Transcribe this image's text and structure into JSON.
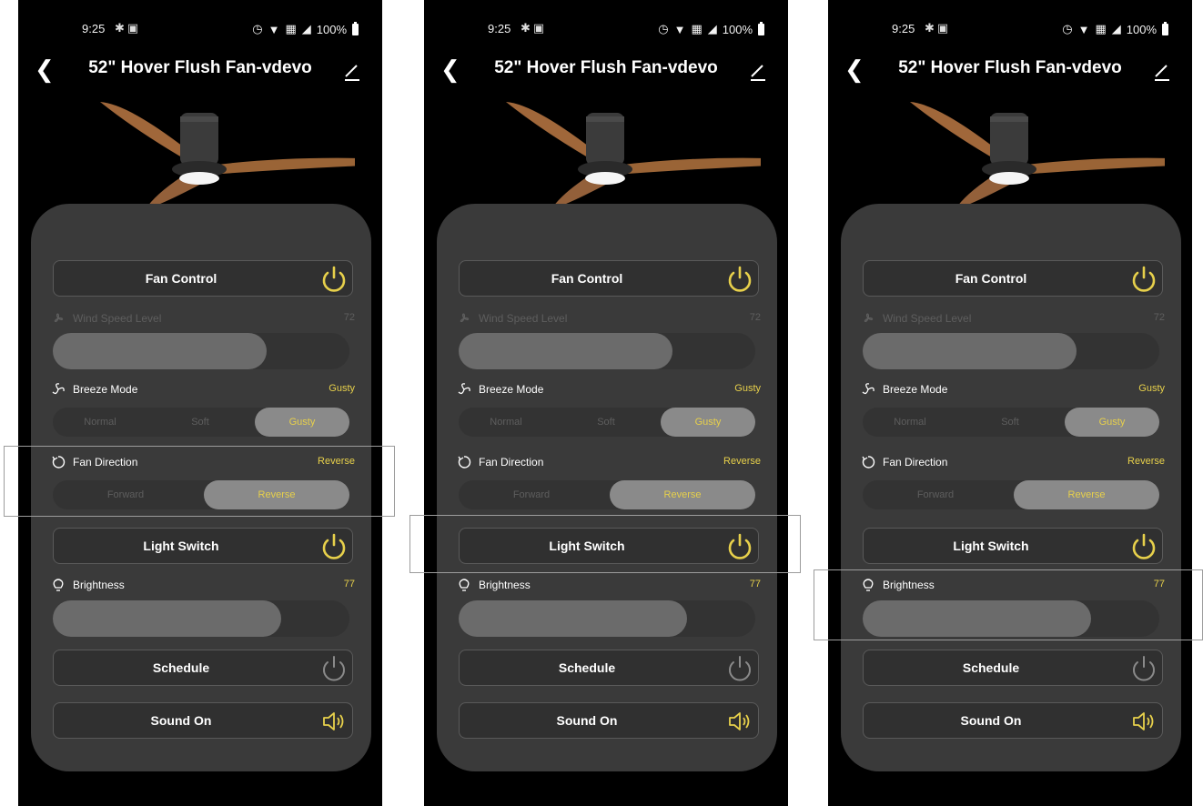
{
  "status": {
    "time": "9:25",
    "battery": "100%"
  },
  "header": {
    "title": "52\" Hover Flush Fan-vdevo"
  },
  "fan_control": {
    "label": "Fan Control"
  },
  "wind_speed": {
    "label": "Wind Speed Level",
    "value": "72",
    "level": 0.72
  },
  "breeze": {
    "label": "Breeze Mode",
    "value": "Gusty",
    "options": [
      "Normal",
      "Soft",
      "Gusty"
    ]
  },
  "direction": {
    "label": "Fan Direction",
    "value": "Reverse",
    "options": [
      "Forward",
      "Reverse"
    ]
  },
  "light_switch": {
    "label": "Light Switch"
  },
  "brightness": {
    "label": "Brightness",
    "value": "77",
    "level": 0.77
  },
  "schedule": {
    "label": "Schedule"
  },
  "sound": {
    "label": "Sound On"
  },
  "colors": {
    "accent": "#e7d04b",
    "card": "#3a3a3a",
    "background": "#000000"
  },
  "icons": [
    "back-icon",
    "edit-icon",
    "fan-icon",
    "breeze-icon",
    "rotate-icon",
    "bulb-icon",
    "power-icon",
    "speaker-icon"
  ]
}
